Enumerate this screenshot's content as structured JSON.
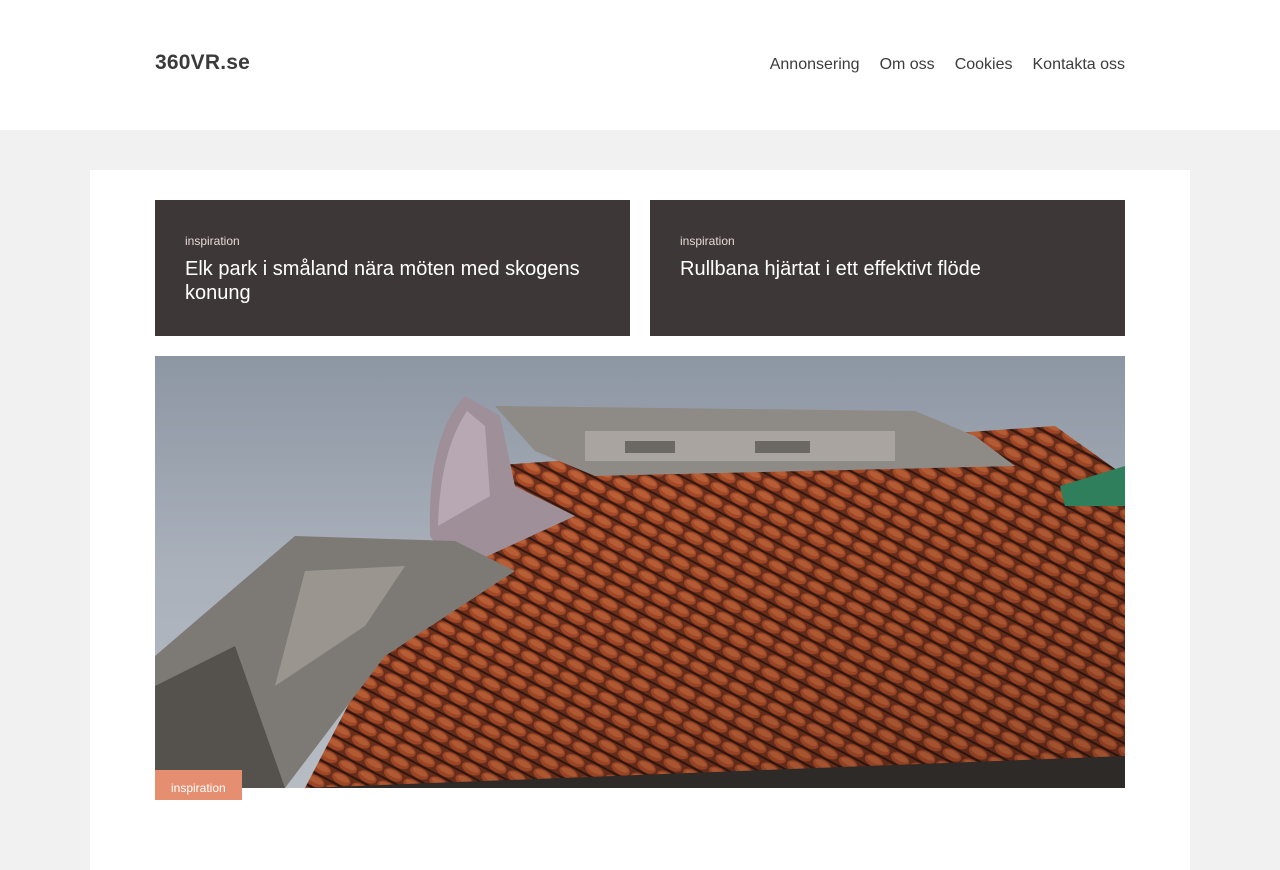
{
  "site": {
    "logo": "360VR.se"
  },
  "nav": {
    "items": [
      "Annonsering",
      "Om oss",
      "Cookies",
      "Kontakta oss"
    ]
  },
  "cards": [
    {
      "category": "inspiration",
      "title": "Elk park i småland nära möten med skogens konung"
    },
    {
      "category": "inspiration",
      "title": "Rullbana hjärtat i ett effektivt flöde"
    }
  ],
  "hero": {
    "category": "inspiration",
    "image": "tiled-roof-photo"
  },
  "colors": {
    "card_bg": "#3d3738",
    "badge_bg": "#e58f70",
    "page_bg": "#f1f1f1"
  }
}
